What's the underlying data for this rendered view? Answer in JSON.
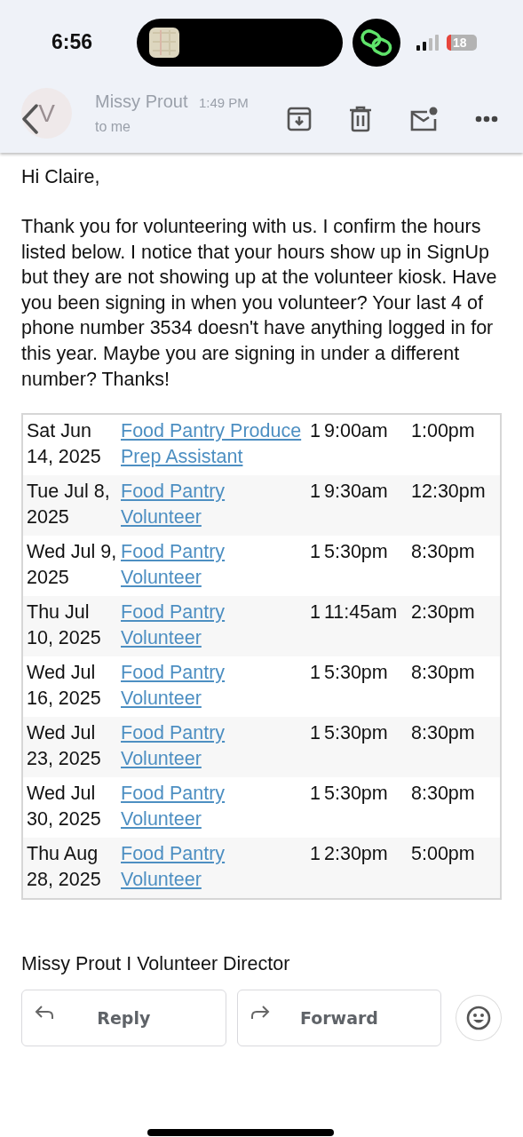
{
  "status_bar": {
    "time": "6:56",
    "battery": "18"
  },
  "header": {
    "sender": "Missy Prout",
    "time": "1:49 PM",
    "recipient": "to me",
    "avatar_letter": "V"
  },
  "body": {
    "greeting": "Hi Claire,",
    "paragraph": "Thank you for volunteering with us. I confirm the hours listed below. I notice that your hours show up in SignUp but they are not showing up at the volunteer kiosk. Have you been signing in when you volunteer? Your last 4 of phone number 3534 doesn't have anything logged in for this year. Maybe you are signing in under a different number? Thanks!"
  },
  "table": {
    "rows": [
      {
        "date": "Sat Jun 14, 2025",
        "role": "Food Pantry Produce Prep Assistant",
        "count": "1",
        "start": "9:00am",
        "end": "1:00pm"
      },
      {
        "date": "Tue Jul 8, 2025",
        "role": "Food Pantry Volunteer",
        "count": "1",
        "start": "9:30am",
        "end": "12:30pm"
      },
      {
        "date": "Wed Jul 9, 2025",
        "role": "Food Pantry Volunteer",
        "count": "1",
        "start": "5:30pm",
        "end": "8:30pm"
      },
      {
        "date": "Thu Jul 10, 2025",
        "role": "Food Pantry Volunteer",
        "count": "1",
        "start": "11:45am",
        "end": "2:30pm"
      },
      {
        "date": "Wed Jul 16, 2025",
        "role": "Food Pantry Volunteer",
        "count": "1",
        "start": "5:30pm",
        "end": "8:30pm"
      },
      {
        "date": "Wed Jul 23, 2025",
        "role": "Food Pantry Volunteer",
        "count": "1",
        "start": "5:30pm",
        "end": "8:30pm"
      },
      {
        "date": "Wed Jul 30, 2025",
        "role": "Food Pantry Volunteer",
        "count": "1",
        "start": "5:30pm",
        "end": "8:30pm"
      },
      {
        "date": "Thu Aug 28, 2025",
        "role": "Food Pantry Volunteer",
        "count": "1",
        "start": "2:30pm",
        "end": "5:00pm"
      }
    ]
  },
  "signature": "Missy Prout I Volunteer Director",
  "actions": [
    {
      "label": "Reply",
      "kind": "reply"
    },
    {
      "label": "Forward",
      "kind": "forward"
    }
  ]
}
